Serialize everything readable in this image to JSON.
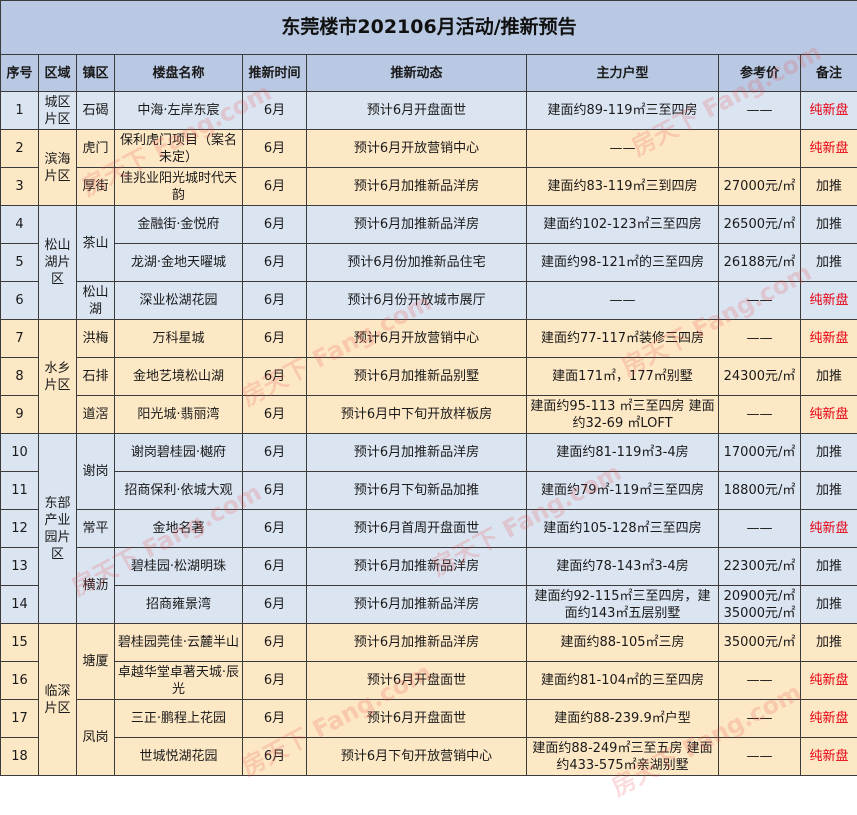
{
  "title": "东莞楼市202106月活动/推新预告",
  "headers": [
    "序号",
    "区域",
    "镇区",
    "楼盘名称",
    "推新时间",
    "推新动态",
    "主力户型",
    "参考价",
    "备注"
  ],
  "regions": [
    "城区片区",
    "滨海片区",
    "松山湖片区",
    "水乡片区",
    "东部产业园片区",
    "临深片区"
  ],
  "towns": [
    "石碣",
    "虎门",
    "厚街",
    "茶山",
    "松山湖",
    "洪梅",
    "石排",
    "道滘",
    "谢岗",
    "常平",
    "横沥",
    "塘厦",
    "凤岗"
  ],
  "rows": [
    {
      "no": "1",
      "name": "中海·左岸东宸",
      "time": "6月",
      "action": "预计6月开盘面世",
      "type": "建面约89-119㎡三至四房",
      "price": "——",
      "note": "纯新盘"
    },
    {
      "no": "2",
      "name": "保利虎门项目（案名未定）",
      "time": "6月",
      "action": "预计6月开放营销中心",
      "type": "——",
      "price": "",
      "note": "纯新盘"
    },
    {
      "no": "3",
      "name": "佳兆业阳光城时代天韵",
      "time": "6月",
      "action": "预计6月加推新品洋房",
      "type": "建面约83-119㎡三到四房",
      "price": "27000元/㎡",
      "note": "加推"
    },
    {
      "no": "4",
      "name": "金融街·金悦府",
      "time": "6月",
      "action": "预计6月加推新品洋房",
      "type": "建面约102-123㎡三至四房",
      "price": "26500元/㎡",
      "note": "加推"
    },
    {
      "no": "5",
      "name": "龙湖·金地天曜城",
      "time": "6月",
      "action": "预计6月份加推新品住宅",
      "type": "建面约98-121㎡的三至四房",
      "price": "26188元/㎡",
      "note": "加推"
    },
    {
      "no": "6",
      "name": "深业松湖花园",
      "time": "6月",
      "action": "预计6月份开放城市展厅",
      "type": "——",
      "price": "——",
      "note": "纯新盘"
    },
    {
      "no": "7",
      "name": "万科星城",
      "time": "6月",
      "action": "预计6月开放营销中心",
      "type": "建面约77-117㎡装修三四房",
      "price": "——",
      "note": "纯新盘"
    },
    {
      "no": "8",
      "name": "金地艺境松山湖",
      "time": "6月",
      "action": "预计6月加推新品别墅",
      "type": "建面171㎡，177㎡别墅",
      "price": "24300元/㎡",
      "note": "加推"
    },
    {
      "no": "9",
      "name": "阳光城·翡丽湾",
      "time": "6月",
      "action": "预计6月中下旬开放样板房",
      "type": "建面约95-113 ㎡三至四房 建面约32-69 ㎡LOFT",
      "price": "——",
      "note": "纯新盘"
    },
    {
      "no": "10",
      "name": "谢岗碧桂园·樾府",
      "time": "6月",
      "action": "预计6月加推新品洋房",
      "type": "建面约81-119㎡3-4房",
      "price": "17000元/㎡",
      "note": "加推"
    },
    {
      "no": "11",
      "name": "招商保利·依城大观",
      "time": "6月",
      "action": "预计6月下旬新品加推",
      "type": "建面约79㎡-119㎡三至四房",
      "price": "18800元/㎡",
      "note": "加推"
    },
    {
      "no": "12",
      "name": "金地名著",
      "time": "6月",
      "action": "预计6月首周开盘面世",
      "type": "建面约105-128㎡三至四房",
      "price": "——",
      "note": "纯新盘"
    },
    {
      "no": "13",
      "name": "碧桂园·松湖明珠",
      "time": "6月",
      "action": "预计6月加推新品洋房",
      "type": "建面约78-143㎡3-4房",
      "price": "22300元/㎡",
      "note": "加推"
    },
    {
      "no": "14",
      "name": "招商雍景湾",
      "time": "6月",
      "action": "预计6月加推新品洋房",
      "type": "建面约92-115㎡三至四房，建面约143㎡五层别墅",
      "price": "20900元/㎡ 35000元/㎡",
      "note": "加推"
    },
    {
      "no": "15",
      "name": "碧桂园莞佳·云麓半山",
      "time": "6月",
      "action": "预计6月加推新品洋房",
      "type": "建面约88-105㎡三房",
      "price": "35000元/㎡",
      "note": "加推"
    },
    {
      "no": "16",
      "name": "卓越华堂卓著天城·辰光",
      "time": "6月",
      "action": "预计6月开盘面世",
      "type": "建面约81-104㎡的三至四房",
      "price": "——",
      "note": "纯新盘"
    },
    {
      "no": "17",
      "name": "三正·鹏程上花园",
      "time": "6月",
      "action": "预计6月开盘面世",
      "type": "建面约88-239.9㎡户型",
      "price": "——",
      "note": "纯新盘"
    },
    {
      "no": "18",
      "name": "世城悦湖花园",
      "time": "6月",
      "action": "预计6月下旬开放营销中心",
      "type": "建面约88-249㎡三至五房 建面约433-575㎡亲湖别墅",
      "price": "——",
      "note": "纯新盘"
    }
  ],
  "watermark": "房天下 Fang.com",
  "colors": {
    "header_bg": "#b9c9e3",
    "row_blue": "#dbe4f1",
    "row_yellow": "#fde8c5",
    "accent_red": "#e60012"
  }
}
